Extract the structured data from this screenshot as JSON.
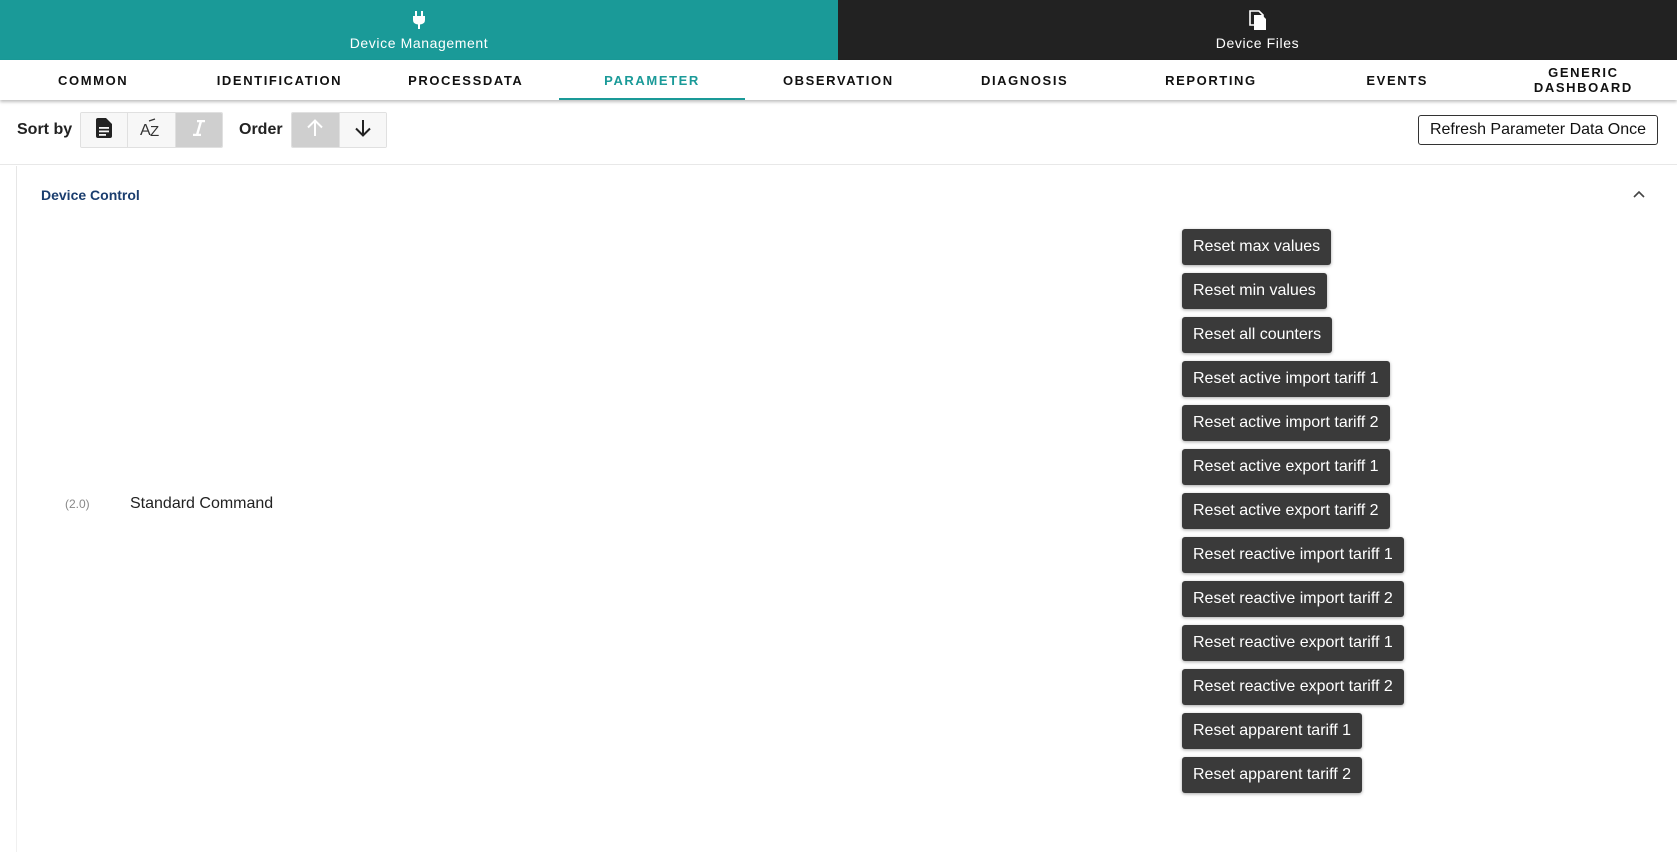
{
  "header": {
    "tabs": [
      {
        "label": "Device Management",
        "icon": "plug-icon",
        "active": true
      },
      {
        "label": "Device Files",
        "icon": "files-icon",
        "active": false
      }
    ],
    "colors": {
      "accent": "#1a9a98",
      "dark": "#222222"
    }
  },
  "nav": {
    "tabs": [
      {
        "label": "COMMON"
      },
      {
        "label": "IDENTIFICATION"
      },
      {
        "label": "PROCESSDATA"
      },
      {
        "label": "PARAMETER",
        "active": true
      },
      {
        "label": "OBSERVATION"
      },
      {
        "label": "DIAGNOSIS"
      },
      {
        "label": "REPORTING"
      },
      {
        "label": "EVENTS"
      },
      {
        "label": "GENERIC DASHBOARD"
      }
    ]
  },
  "toolbar": {
    "sort_label": "Sort by",
    "sort_options": [
      {
        "icon": "document-icon",
        "selected": false
      },
      {
        "icon": "sort-alpha-icon",
        "selected": false
      },
      {
        "icon": "italic-icon",
        "selected": true
      }
    ],
    "order_label": "Order",
    "order_options": [
      {
        "icon": "arrow-up-icon",
        "selected": true
      },
      {
        "icon": "arrow-down-icon",
        "selected": false
      }
    ],
    "refresh_label": "Refresh Parameter Data Once"
  },
  "section": {
    "title": "Device Control",
    "title_color": "#1a3d6e",
    "parameter": {
      "index": "(2.0)",
      "name": "Standard Command"
    },
    "commands": [
      "Reset max values",
      "Reset min values",
      "Reset all counters",
      "Reset active import tariff 1",
      "Reset active import tariff 2",
      "Reset active export tariff 1",
      "Reset active export tariff 2",
      "Reset reactive import tariff 1",
      "Reset reactive import tariff 2",
      "Reset reactive export tariff 1",
      "Reset reactive export tariff 2",
      "Reset apparent tariff 1",
      "Reset apparent tariff 2"
    ]
  }
}
